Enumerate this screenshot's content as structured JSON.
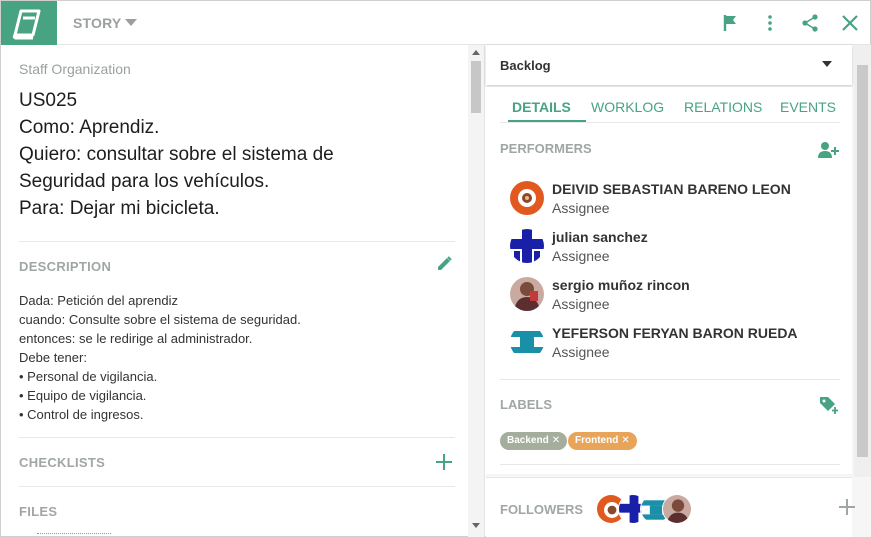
{
  "header": {
    "type_label": "STORY",
    "icons": [
      "book-icon",
      "flag-icon",
      "more-vert-icon",
      "share-icon",
      "close-icon"
    ]
  },
  "story": {
    "project": "Staff Organization",
    "lines": [
      "US025",
      "Como: Aprendiz.",
      "Quiero: consultar sobre el sistema de",
      "Seguridad para los vehículos.",
      "Para: Dejar mi bicicleta."
    ]
  },
  "description": {
    "title": "DESCRIPTION",
    "lines": [
      "Dada: Petición del aprendiz",
      "cuando: Consulte sobre el sistema de seguridad.",
      "entonces: se le redirige al administrador.",
      "Debe tener:",
      "• Personal de vigilancia.",
      "• Equipo de vigilancia.",
      "• Control de ingresos."
    ]
  },
  "checklists": {
    "title": "CHECKLISTS"
  },
  "files": {
    "title": "FILES"
  },
  "status": {
    "label": "Backlog"
  },
  "tabs": [
    "DETAILS",
    "WORKLOG",
    "RELATIONS",
    "EVENTS"
  ],
  "performers": {
    "title": "PERFORMERS",
    "people": [
      {
        "name": "DEIVID SEBASTIAN BARENO LEON",
        "role": "Assignee"
      },
      {
        "name": "julian sanchez",
        "role": "Assignee"
      },
      {
        "name": "sergio muñoz rincon",
        "role": "Assignee"
      },
      {
        "name": "YEFERSON FERYAN BARON RUEDA",
        "role": "Assignee"
      }
    ]
  },
  "labels": {
    "title": "LABELS",
    "items": [
      {
        "text": "Backend",
        "color": "#a5ad9c"
      },
      {
        "text": "Frontend",
        "color": "#e8a55a"
      }
    ]
  },
  "followers": {
    "title": "FOLLOWERS"
  },
  "colors": {
    "accent": "#47a382",
    "muted": "#a0a6a6"
  }
}
